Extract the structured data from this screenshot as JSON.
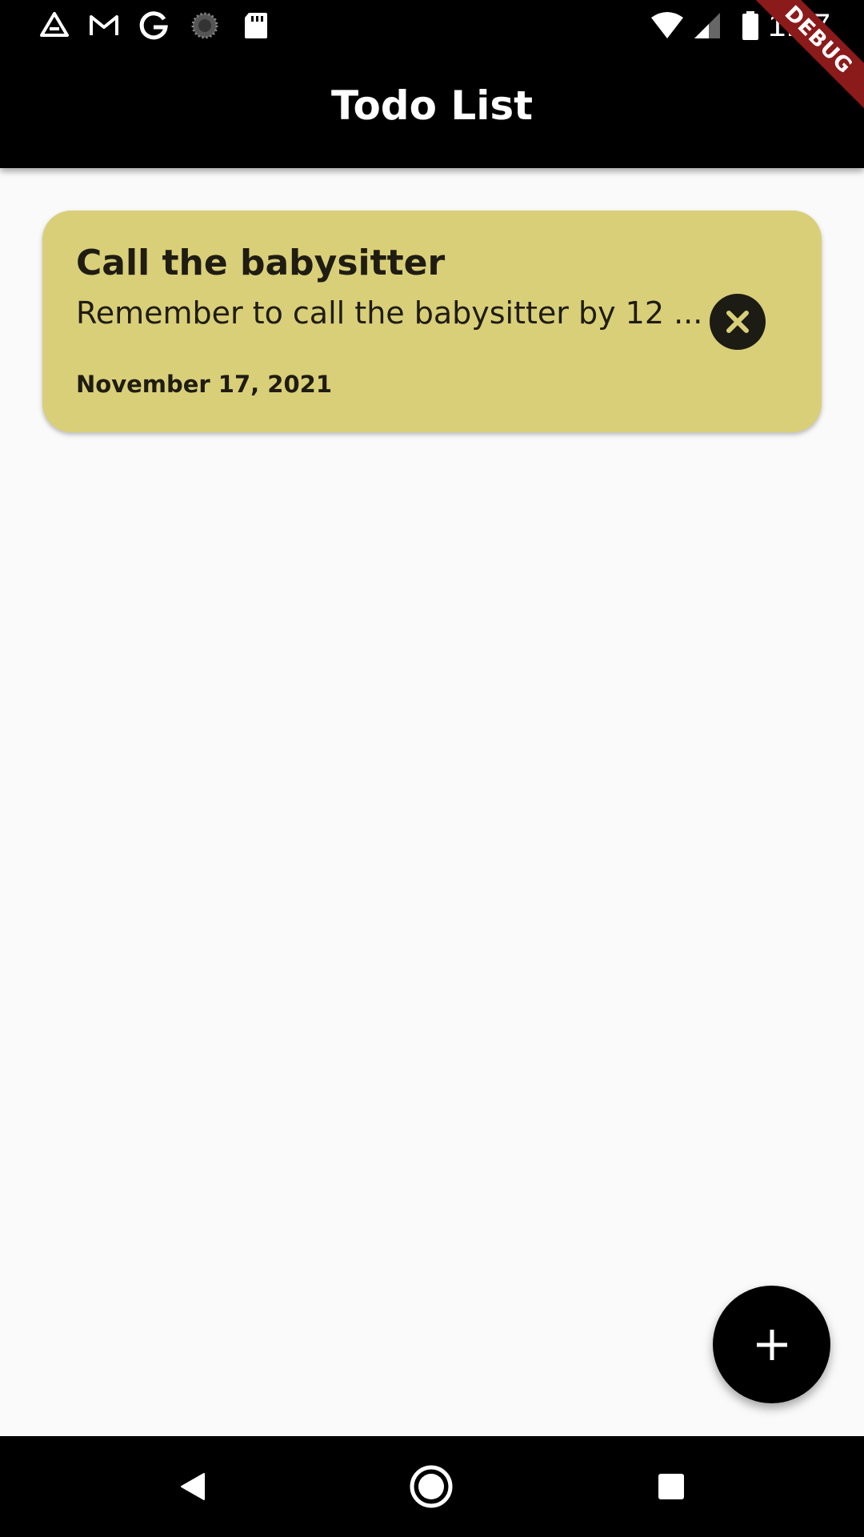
{
  "status_bar": {
    "time": "1:27",
    "icons": [
      "drive-icon",
      "gmail-icon",
      "google-icon",
      "sync-icon",
      "sd-card-icon",
      "wifi-icon",
      "signal-icon",
      "battery-icon"
    ]
  },
  "debug_banner": {
    "label": "DEBUG",
    "color": "#8b1a1a"
  },
  "app_bar": {
    "title": "Todo List"
  },
  "todos": [
    {
      "title": "Call the babysitter",
      "description": "Remember to call the babysitter by 12 ...",
      "date": "November 17, 2021",
      "card_color": "#d9cf79"
    }
  ],
  "fab": {
    "icon": "plus-icon"
  },
  "nav_bar": {
    "buttons": [
      "back-icon",
      "home-icon",
      "recents-icon"
    ]
  }
}
